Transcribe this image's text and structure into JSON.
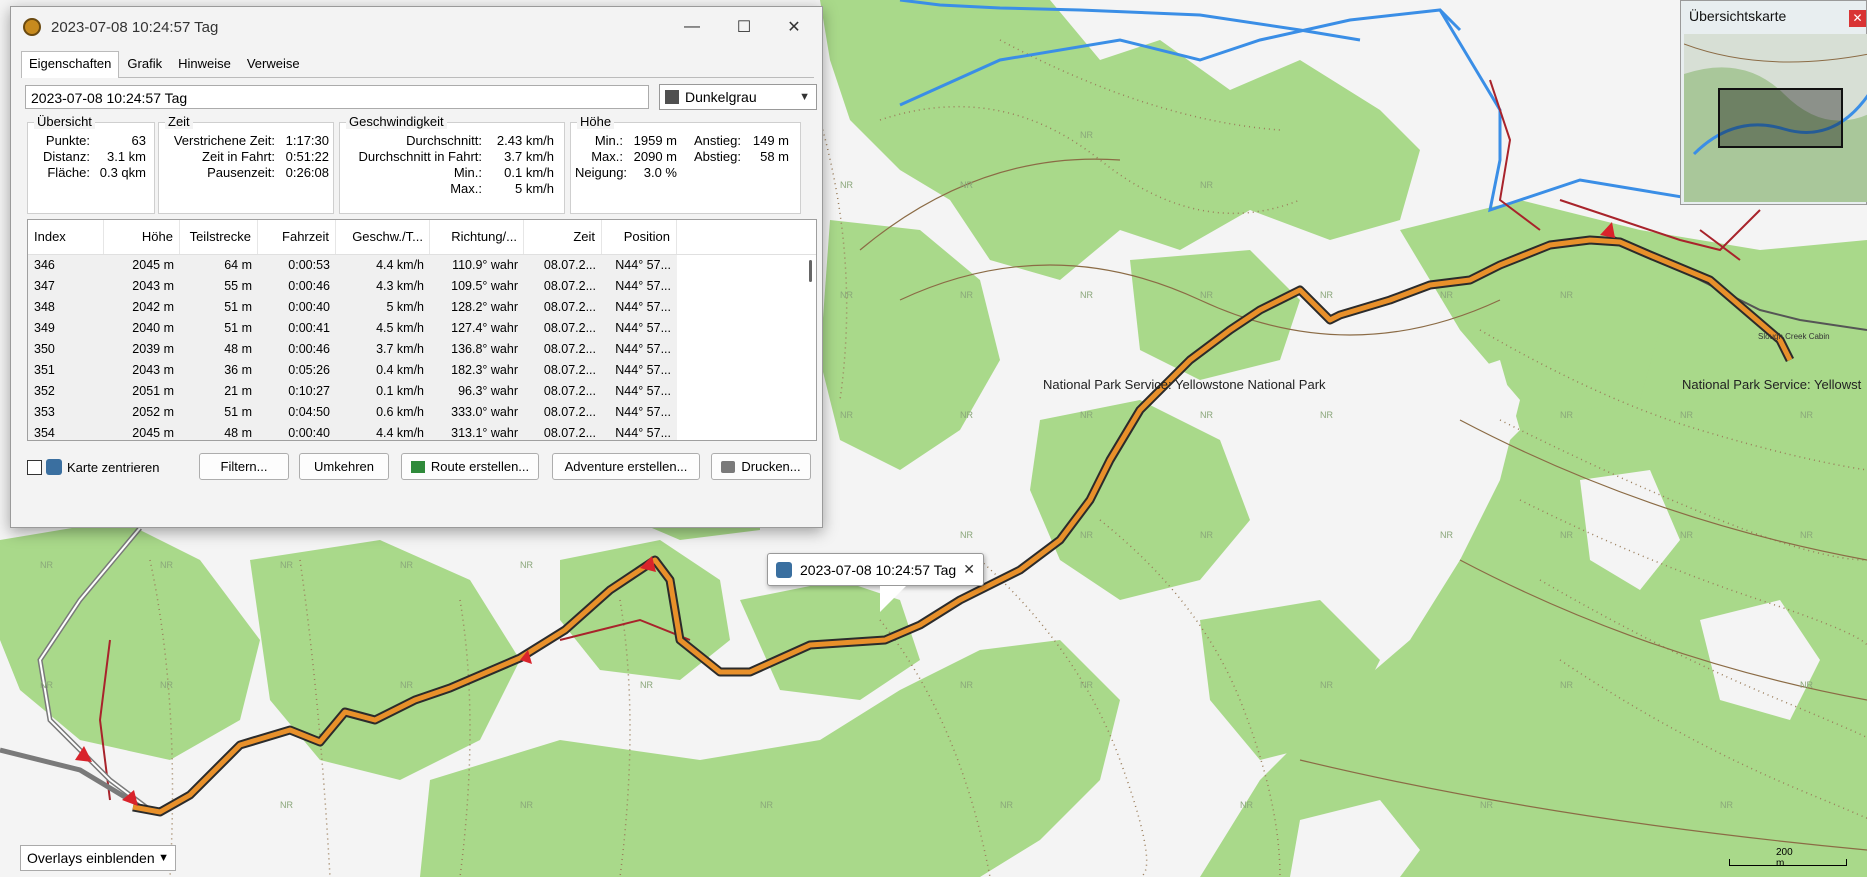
{
  "window": {
    "title": "2023-07-08 10:24:57 Tag",
    "minimize_icon": "minimize-icon",
    "maximize_icon": "maximize-icon",
    "close_icon": "close-icon"
  },
  "tabs": [
    {
      "label": "Eigenschaften",
      "active": true
    },
    {
      "label": "Grafik",
      "active": false
    },
    {
      "label": "Hinweise",
      "active": false
    },
    {
      "label": "Verweise",
      "active": false
    }
  ],
  "name_field": {
    "value": "2023-07-08 10:24:57 Tag"
  },
  "color_select": {
    "value": "Dunkelgrau",
    "swatch_color": "#505050"
  },
  "uebersicht": {
    "title": "Übersicht",
    "punkte_label": "Punkte:",
    "punkte_value": "63",
    "distanz_label": "Distanz:",
    "distanz_value": "3.1 km",
    "flaeche_label": "Fläche:",
    "flaeche_value": "0.3 qkm"
  },
  "zeit": {
    "title": "Zeit",
    "verstrichen_label": "Verstrichene Zeit:",
    "verstrichen_value": "1:17:30",
    "fahrt_label": "Zeit in Fahrt:",
    "fahrt_value": "0:51:22",
    "pause_label": "Pausenzeit:",
    "pause_value": "0:26:08"
  },
  "geschwindigkeit": {
    "title": "Geschwindigkeit",
    "durchschnitt_label": "Durchschnitt:",
    "durchschnitt_value": "2.43 km/h",
    "fahrt_label": "Durchschnitt in Fahrt:",
    "fahrt_value": "3.7 km/h",
    "min_label": "Min.:",
    "min_value": "0.1 km/h",
    "max_label": "Max.:",
    "max_value": "5 km/h"
  },
  "hoehe": {
    "title": "Höhe",
    "min_label": "Min.:",
    "min_value": "1959 m",
    "max_label": "Max.:",
    "max_value": "2090 m",
    "neigung_label": "Neigung:",
    "neigung_value": "3.0 %",
    "anstieg_label": "Anstieg:",
    "anstieg_value": "149 m",
    "abstieg_label": "Abstieg:",
    "abstieg_value": "58 m"
  },
  "table": {
    "headers": [
      "Index",
      "Höhe",
      "Teilstrecke",
      "Fahrzeit",
      "Geschw./T...",
      "Richtung/...",
      "Zeit",
      "Position"
    ],
    "rows": [
      [
        "346",
        "2045 m",
        "64 m",
        "0:00:53",
        "4.4 km/h",
        "110.9° wahr",
        "08.07.2...",
        "N44° 57..."
      ],
      [
        "347",
        "2043 m",
        "55 m",
        "0:00:46",
        "4.3 km/h",
        "109.5° wahr",
        "08.07.2...",
        "N44° 57..."
      ],
      [
        "348",
        "2042 m",
        "51 m",
        "0:00:40",
        "5 km/h",
        "128.2° wahr",
        "08.07.2...",
        "N44° 57..."
      ],
      [
        "349",
        "2040 m",
        "51 m",
        "0:00:41",
        "4.5 km/h",
        "127.4° wahr",
        "08.07.2...",
        "N44° 57..."
      ],
      [
        "350",
        "2039 m",
        "48 m",
        "0:00:46",
        "3.7 km/h",
        "136.8° wahr",
        "08.07.2...",
        "N44° 57..."
      ],
      [
        "351",
        "2043 m",
        "36 m",
        "0:05:26",
        "0.4 km/h",
        "182.3° wahr",
        "08.07.2...",
        "N44° 57..."
      ],
      [
        "352",
        "2051 m",
        "21 m",
        "0:10:27",
        "0.1 km/h",
        "96.3° wahr",
        "08.07.2...",
        "N44° 57..."
      ],
      [
        "353",
        "2052 m",
        "51 m",
        "0:04:50",
        "0.6 km/h",
        "333.0° wahr",
        "08.07.2...",
        "N44° 57..."
      ],
      [
        "354",
        "2045 m",
        "48 m",
        "0:00:40",
        "4.4 km/h",
        "313.1° wahr",
        "08.07.2...",
        "N44° 57..."
      ]
    ]
  },
  "buttons": {
    "karte_zentrieren": "Karte zentrieren",
    "filtern": "Filtern...",
    "umkehren": "Umkehren",
    "route": "Route erstellen...",
    "adventure": "Adventure erstellen...",
    "drucken": "Drucken..."
  },
  "map": {
    "tooltip": "2023-07-08 10:24:57 Tag",
    "label_park_1": "National Park Service: Yellowstone National Park",
    "label_park_2": "National Park Service: Yellowst",
    "label_cabin": "Slough Creek Cabin",
    "nr": "NR",
    "overlays_select": "Overlays einblenden",
    "scale": "200 m",
    "overview_title": "Übersichtskarte",
    "track_color": "#e8902a",
    "green_color": "#a9d98a"
  }
}
